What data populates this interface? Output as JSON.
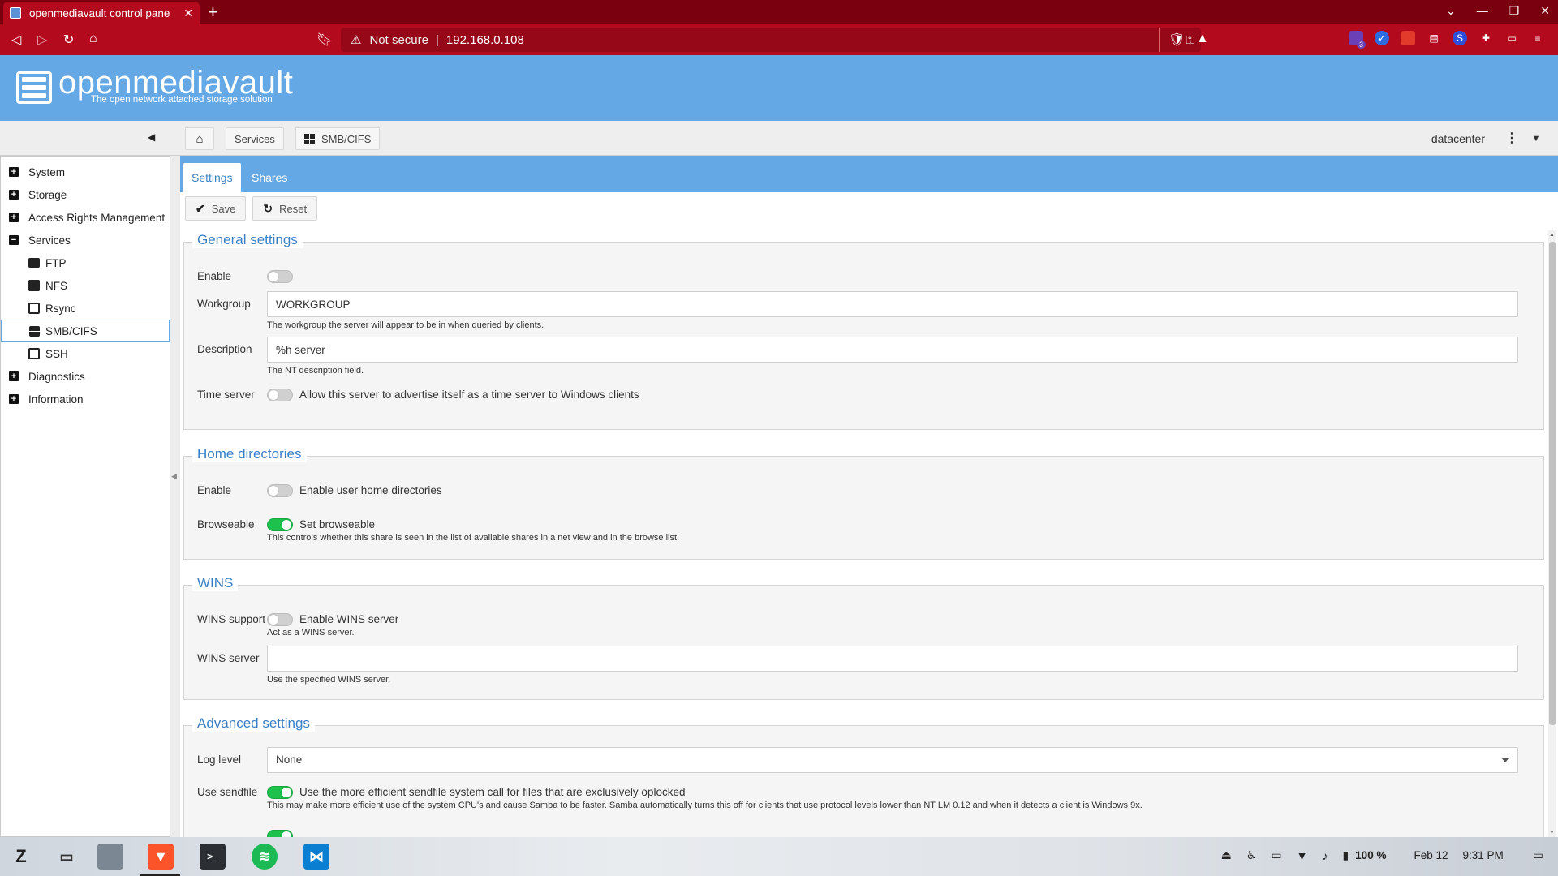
{
  "browser": {
    "tab_title": "openmediavault control pane",
    "url_warning": "Not secure",
    "url": "192.168.0.108",
    "ext_badge_count": "3"
  },
  "header": {
    "brand": "openmediavault",
    "tagline": "The open network attached storage solution"
  },
  "breadcrumb": {
    "items": [
      "Services",
      "SMB/CIFS"
    ],
    "user": "datacenter"
  },
  "sidebar": {
    "items": [
      {
        "label": "System",
        "kind": "collapsed"
      },
      {
        "label": "Storage",
        "kind": "collapsed"
      },
      {
        "label": "Access Rights Management",
        "kind": "collapsed"
      },
      {
        "label": "Services",
        "kind": "expanded"
      },
      {
        "label": "FTP",
        "kind": "child"
      },
      {
        "label": "NFS",
        "kind": "child"
      },
      {
        "label": "Rsync",
        "kind": "child"
      },
      {
        "label": "SMB/CIFS",
        "kind": "child-active"
      },
      {
        "label": "SSH",
        "kind": "child"
      },
      {
        "label": "Diagnostics",
        "kind": "collapsed"
      },
      {
        "label": "Information",
        "kind": "collapsed"
      }
    ]
  },
  "tabs": [
    "Settings",
    "Shares"
  ],
  "actions": {
    "save": "Save",
    "reset": "Reset"
  },
  "general": {
    "title": "General settings",
    "enable_label": "Enable",
    "enable_on": false,
    "workgroup_label": "Workgroup",
    "workgroup_value": "WORKGROUP",
    "workgroup_hint": "The workgroup the server will appear to be in when queried by clients.",
    "description_label": "Description",
    "description_value": "%h server",
    "description_hint": "The NT description field.",
    "timeserver_label": "Time server",
    "timeserver_on": false,
    "timeserver_text": "Allow this server to advertise itself as a time server to Windows clients"
  },
  "home": {
    "title": "Home directories",
    "enable_label": "Enable",
    "enable_on": false,
    "enable_text": "Enable user home directories",
    "browseable_label": "Browseable",
    "browseable_on": true,
    "browseable_text": "Set browseable",
    "browseable_hint": "This controls whether this share is seen in the list of available shares in a net view and in the browse list."
  },
  "wins": {
    "title": "WINS",
    "support_label": "WINS support",
    "support_on": false,
    "support_text": "Enable WINS server",
    "support_hint": "Act as a WINS server.",
    "server_label": "WINS server",
    "server_value": "",
    "server_hint": "Use the specified WINS server."
  },
  "advanced": {
    "title": "Advanced settings",
    "loglevel_label": "Log level",
    "loglevel_value": "None",
    "sendfile_label": "Use sendfile",
    "sendfile_on": true,
    "sendfile_text": "Use the more efficient sendfile system call for files that are exclusively oplocked",
    "sendfile_hint": "This may make more efficient use of the system CPU's and cause Samba to be faster. Samba automatically turns this off for clients that use protocol levels lower than NT LM 0.12 and when it detects a client is Windows 9x."
  },
  "taskbar": {
    "battery": "100 %",
    "date": "Feb 12",
    "time": "9:31 PM"
  },
  "colors": {
    "browser_chrome": "#b40a1e",
    "omv_blue": "#65a8e6",
    "toggle_on": "#1fc14d"
  }
}
